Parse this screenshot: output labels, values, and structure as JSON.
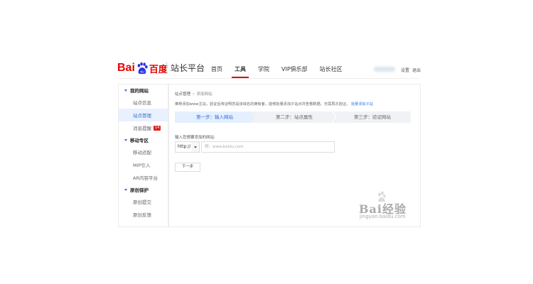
{
  "header": {
    "logo_latin": "Bai",
    "logo_chinese": "百度",
    "product": "站长平台",
    "nav": [
      {
        "label": "首页",
        "active": false
      },
      {
        "label": "工具",
        "active": true
      },
      {
        "label": "学院",
        "active": false
      },
      {
        "label": "VIP俱乐部",
        "active": false
      },
      {
        "label": "站长社区",
        "active": false
      }
    ],
    "settings": "设置",
    "logout": "退出"
  },
  "sidebar": {
    "sections": [
      {
        "title": "我的网站",
        "items": [
          {
            "label": "站点信息",
            "active": false,
            "badge": ""
          },
          {
            "label": "站点管理",
            "active": true,
            "badge": ""
          },
          {
            "label": "消息提醒",
            "active": false,
            "badge": "14"
          }
        ]
      },
      {
        "title": "移动专区",
        "items": [
          {
            "label": "移动适配",
            "active": false,
            "badge": ""
          },
          {
            "label": "MIP引入",
            "active": false,
            "badge": ""
          },
          {
            "label": "AR内容平台",
            "active": false,
            "badge": ""
          }
        ]
      },
      {
        "title": "原创保护",
        "items": [
          {
            "label": "原创提交",
            "active": false,
            "badge": ""
          },
          {
            "label": "原创反馈",
            "active": false,
            "badge": ""
          }
        ]
      }
    ]
  },
  "main": {
    "breadcrumb": {
      "root": "站点管理",
      "sep": ">",
      "current": "添加网站"
    },
    "notice_text": "推荐添加www主站，验证后将证明您是该域名的拥有者，能够批量添加子站点并查看数据，无需再次验证。",
    "notice_link": "批量添加子站",
    "steps": [
      "第一步：输入网站",
      "第二步：站点属性",
      "第三步：验证网站"
    ],
    "active_step": 0,
    "field_label": "输入您想要添加的网站:",
    "protocol": "http://",
    "url_placeholder": "例：www.baidu.com",
    "next_button": "下一步"
  },
  "watermark": {
    "text": "Bai经验",
    "sub": "jingyan.baidu.com"
  },
  "colors": {
    "brand_red": "#e10601",
    "accent_blue": "#2f6fd6",
    "badge_red": "#e02020"
  }
}
